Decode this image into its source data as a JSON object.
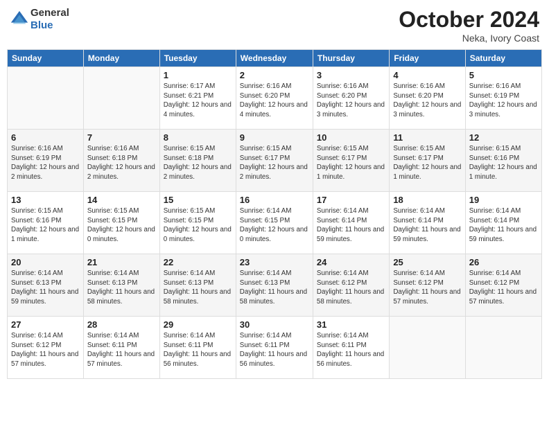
{
  "logo": {
    "general": "General",
    "blue": "Blue"
  },
  "header": {
    "month": "October 2024",
    "location": "Neka, Ivory Coast"
  },
  "weekdays": [
    "Sunday",
    "Monday",
    "Tuesday",
    "Wednesday",
    "Thursday",
    "Friday",
    "Saturday"
  ],
  "weeks": [
    [
      {
        "day": "",
        "sunrise": "",
        "sunset": "",
        "daylight": ""
      },
      {
        "day": "",
        "sunrise": "",
        "sunset": "",
        "daylight": ""
      },
      {
        "day": "1",
        "sunrise": "Sunrise: 6:17 AM",
        "sunset": "Sunset: 6:21 PM",
        "daylight": "Daylight: 12 hours and 4 minutes."
      },
      {
        "day": "2",
        "sunrise": "Sunrise: 6:16 AM",
        "sunset": "Sunset: 6:20 PM",
        "daylight": "Daylight: 12 hours and 4 minutes."
      },
      {
        "day": "3",
        "sunrise": "Sunrise: 6:16 AM",
        "sunset": "Sunset: 6:20 PM",
        "daylight": "Daylight: 12 hours and 3 minutes."
      },
      {
        "day": "4",
        "sunrise": "Sunrise: 6:16 AM",
        "sunset": "Sunset: 6:20 PM",
        "daylight": "Daylight: 12 hours and 3 minutes."
      },
      {
        "day": "5",
        "sunrise": "Sunrise: 6:16 AM",
        "sunset": "Sunset: 6:19 PM",
        "daylight": "Daylight: 12 hours and 3 minutes."
      }
    ],
    [
      {
        "day": "6",
        "sunrise": "Sunrise: 6:16 AM",
        "sunset": "Sunset: 6:19 PM",
        "daylight": "Daylight: 12 hours and 2 minutes."
      },
      {
        "day": "7",
        "sunrise": "Sunrise: 6:16 AM",
        "sunset": "Sunset: 6:18 PM",
        "daylight": "Daylight: 12 hours and 2 minutes."
      },
      {
        "day": "8",
        "sunrise": "Sunrise: 6:15 AM",
        "sunset": "Sunset: 6:18 PM",
        "daylight": "Daylight: 12 hours and 2 minutes."
      },
      {
        "day": "9",
        "sunrise": "Sunrise: 6:15 AM",
        "sunset": "Sunset: 6:17 PM",
        "daylight": "Daylight: 12 hours and 2 minutes."
      },
      {
        "day": "10",
        "sunrise": "Sunrise: 6:15 AM",
        "sunset": "Sunset: 6:17 PM",
        "daylight": "Daylight: 12 hours and 1 minute."
      },
      {
        "day": "11",
        "sunrise": "Sunrise: 6:15 AM",
        "sunset": "Sunset: 6:17 PM",
        "daylight": "Daylight: 12 hours and 1 minute."
      },
      {
        "day": "12",
        "sunrise": "Sunrise: 6:15 AM",
        "sunset": "Sunset: 6:16 PM",
        "daylight": "Daylight: 12 hours and 1 minute."
      }
    ],
    [
      {
        "day": "13",
        "sunrise": "Sunrise: 6:15 AM",
        "sunset": "Sunset: 6:16 PM",
        "daylight": "Daylight: 12 hours and 1 minute."
      },
      {
        "day": "14",
        "sunrise": "Sunrise: 6:15 AM",
        "sunset": "Sunset: 6:15 PM",
        "daylight": "Daylight: 12 hours and 0 minutes."
      },
      {
        "day": "15",
        "sunrise": "Sunrise: 6:15 AM",
        "sunset": "Sunset: 6:15 PM",
        "daylight": "Daylight: 12 hours and 0 minutes."
      },
      {
        "day": "16",
        "sunrise": "Sunrise: 6:14 AM",
        "sunset": "Sunset: 6:15 PM",
        "daylight": "Daylight: 12 hours and 0 minutes."
      },
      {
        "day": "17",
        "sunrise": "Sunrise: 6:14 AM",
        "sunset": "Sunset: 6:14 PM",
        "daylight": "Daylight: 11 hours and 59 minutes."
      },
      {
        "day": "18",
        "sunrise": "Sunrise: 6:14 AM",
        "sunset": "Sunset: 6:14 PM",
        "daylight": "Daylight: 11 hours and 59 minutes."
      },
      {
        "day": "19",
        "sunrise": "Sunrise: 6:14 AM",
        "sunset": "Sunset: 6:14 PM",
        "daylight": "Daylight: 11 hours and 59 minutes."
      }
    ],
    [
      {
        "day": "20",
        "sunrise": "Sunrise: 6:14 AM",
        "sunset": "Sunset: 6:13 PM",
        "daylight": "Daylight: 11 hours and 59 minutes."
      },
      {
        "day": "21",
        "sunrise": "Sunrise: 6:14 AM",
        "sunset": "Sunset: 6:13 PM",
        "daylight": "Daylight: 11 hours and 58 minutes."
      },
      {
        "day": "22",
        "sunrise": "Sunrise: 6:14 AM",
        "sunset": "Sunset: 6:13 PM",
        "daylight": "Daylight: 11 hours and 58 minutes."
      },
      {
        "day": "23",
        "sunrise": "Sunrise: 6:14 AM",
        "sunset": "Sunset: 6:13 PM",
        "daylight": "Daylight: 11 hours and 58 minutes."
      },
      {
        "day": "24",
        "sunrise": "Sunrise: 6:14 AM",
        "sunset": "Sunset: 6:12 PM",
        "daylight": "Daylight: 11 hours and 58 minutes."
      },
      {
        "day": "25",
        "sunrise": "Sunrise: 6:14 AM",
        "sunset": "Sunset: 6:12 PM",
        "daylight": "Daylight: 11 hours and 57 minutes."
      },
      {
        "day": "26",
        "sunrise": "Sunrise: 6:14 AM",
        "sunset": "Sunset: 6:12 PM",
        "daylight": "Daylight: 11 hours and 57 minutes."
      }
    ],
    [
      {
        "day": "27",
        "sunrise": "Sunrise: 6:14 AM",
        "sunset": "Sunset: 6:12 PM",
        "daylight": "Daylight: 11 hours and 57 minutes."
      },
      {
        "day": "28",
        "sunrise": "Sunrise: 6:14 AM",
        "sunset": "Sunset: 6:11 PM",
        "daylight": "Daylight: 11 hours and 57 minutes."
      },
      {
        "day": "29",
        "sunrise": "Sunrise: 6:14 AM",
        "sunset": "Sunset: 6:11 PM",
        "daylight": "Daylight: 11 hours and 56 minutes."
      },
      {
        "day": "30",
        "sunrise": "Sunrise: 6:14 AM",
        "sunset": "Sunset: 6:11 PM",
        "daylight": "Daylight: 11 hours and 56 minutes."
      },
      {
        "day": "31",
        "sunrise": "Sunrise: 6:14 AM",
        "sunset": "Sunset: 6:11 PM",
        "daylight": "Daylight: 11 hours and 56 minutes."
      },
      {
        "day": "",
        "sunrise": "",
        "sunset": "",
        "daylight": ""
      },
      {
        "day": "",
        "sunrise": "",
        "sunset": "",
        "daylight": ""
      }
    ]
  ]
}
